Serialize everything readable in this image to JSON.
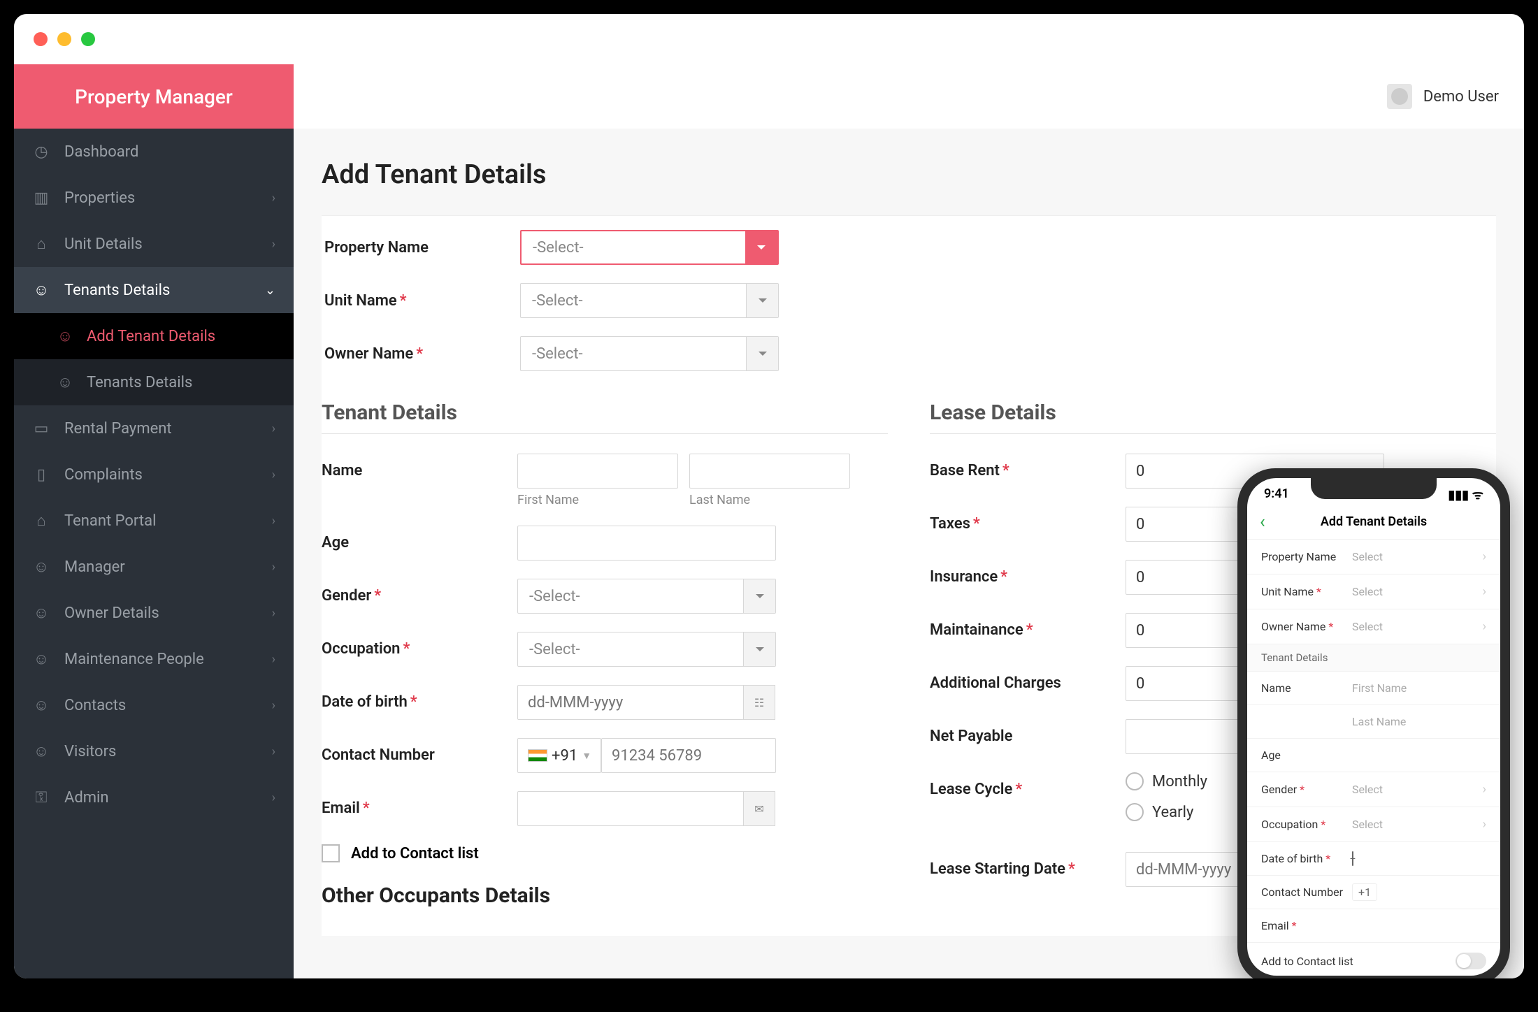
{
  "brand": "Property Manager",
  "user": "Demo User",
  "nav": {
    "dashboard": "Dashboard",
    "properties": "Properties",
    "unit_details": "Unit Details",
    "tenants_details": "Tenants Details",
    "add_tenant": "Add Tenant Details",
    "tenants_details_sub": "Tenants Details",
    "rental_payment": "Rental Payment",
    "complaints": "Complaints",
    "tenant_portal": "Tenant Portal",
    "manager": "Manager",
    "owner_details": "Owner Details",
    "maintenance_people": "Maintenance People",
    "contacts": "Contacts",
    "visitors": "Visitors",
    "admin": "Admin"
  },
  "page_title": "Add Tenant Details",
  "top_fields": {
    "property_name_label": "Property Name",
    "unit_name_label": "Unit Name",
    "owner_name_label": "Owner Name",
    "select_placeholder": "-Select-"
  },
  "tenant_section": "Tenant Details",
  "tenant": {
    "name": "Name",
    "first_name_hint": "First Name",
    "last_name_hint": "Last Name",
    "age": "Age",
    "gender": "Gender",
    "occupation": "Occupation",
    "dob": "Date of birth",
    "dob_placeholder": "dd-MMM-yyyy",
    "contact": "Contact Number",
    "dial_code": "+91",
    "phone_placeholder": "91234 56789",
    "email": "Email",
    "add_to_contacts": "Add to Contact list"
  },
  "lease_section": "Lease Details",
  "lease": {
    "base_rent": "Base Rent",
    "taxes": "Taxes",
    "insurance": "Insurance",
    "maintenance": "Maintainance",
    "additional": "Additional Charges",
    "net_payable": "Net Payable",
    "lease_cycle": "Lease Cycle",
    "monthly": "Monthly",
    "yearly": "Yearly",
    "start_date": "Lease Starting Date",
    "zero": "0"
  },
  "other_occupants": "Other Occupants Details",
  "phone": {
    "time": "9:41",
    "title": "Add Tenant Details",
    "property_name": "Property Name",
    "unit_name": "Unit Name",
    "owner_name": "Owner Name",
    "select": "Select",
    "tenant_details": "Tenant Details",
    "name": "Name",
    "first_name": "First Name",
    "last_name": "Last Name",
    "age": "Age",
    "gender": "Gender",
    "occupation": "Occupation",
    "dob": "Date of birth",
    "contact": "Contact Number",
    "dial": "+1",
    "email": "Email",
    "add_to": "Add to Contact list"
  }
}
